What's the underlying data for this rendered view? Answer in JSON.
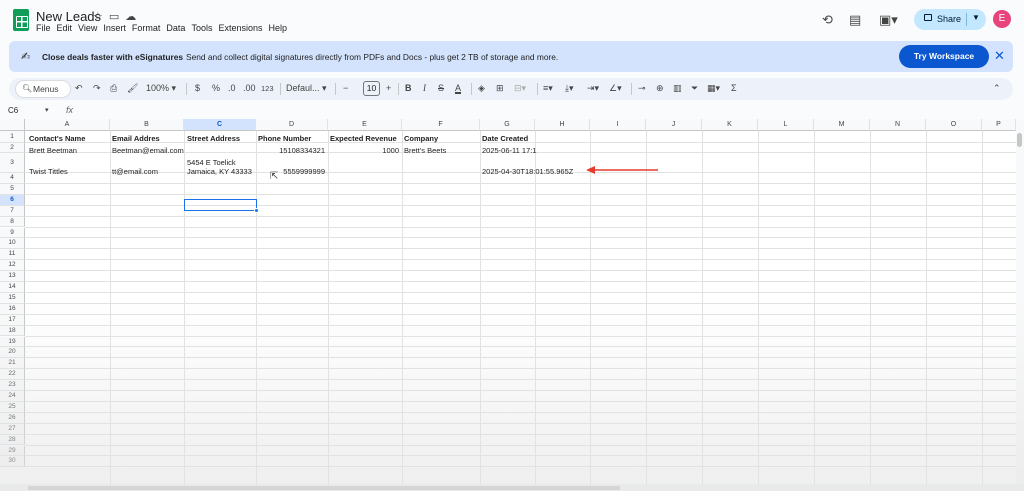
{
  "doc": {
    "title": "New Leads"
  },
  "menu": [
    "File",
    "Edit",
    "View",
    "Insert",
    "Format",
    "Data",
    "Tools",
    "Extensions",
    "Help"
  ],
  "share": {
    "label": "Share"
  },
  "avatar": {
    "initial": "E",
    "color": "#e8437b"
  },
  "banner": {
    "title": "Close deals faster with eSignatures",
    "description": "Send and collect digital signatures directly from PDFs and Docs - plus get 2 TB of storage and more.",
    "button": "Try Workspace"
  },
  "toolbar": {
    "menus": "Menus",
    "zoom": "100%",
    "currency": "$",
    "percent": "%",
    "dec_decrease": ".0",
    "dec_increase": ".00",
    "number_format": "123",
    "font": "Defaul...",
    "font_size": "10",
    "bold": "B",
    "italic": "I"
  },
  "formula_bar": {
    "cell_ref": "C6",
    "fx": "fx"
  },
  "columns": [
    "A",
    "B",
    "C",
    "D",
    "E",
    "F",
    "G",
    "H",
    "I",
    "J",
    "K",
    "L",
    "M",
    "N",
    "O",
    "P"
  ],
  "selected_column": "C",
  "selected_row": 6,
  "rows": {
    "header": [
      "Contact's Name",
      "Email Addres",
      "Street Address",
      "Phone Number",
      "Expected Revenue",
      "Company",
      "Date Created"
    ],
    "row2": [
      "Brett Beetman",
      "Beetman@email.com",
      "",
      "15108334321",
      "1000",
      "Brett's Beets",
      "2025-06-11 17:1"
    ],
    "row3": [
      "Twist Tittles",
      "tt@email.com",
      "5454 E Toelick",
      "5559999999",
      "",
      "",
      "2025-04-30T18:01:55.965Z"
    ],
    "row3_street_line2": "Jamaica, KY 43333"
  },
  "row_numbers": [
    "1",
    "2",
    "3",
    "4",
    "5",
    "6",
    "7",
    "8",
    "9",
    "10",
    "11",
    "12",
    "13",
    "14",
    "15",
    "16",
    "17",
    "18",
    "19",
    "20",
    "21",
    "22",
    "23",
    "24",
    "25",
    "26",
    "27",
    "28",
    "29",
    "30"
  ],
  "annotation": {
    "arrow_color": "#e53c2e"
  }
}
